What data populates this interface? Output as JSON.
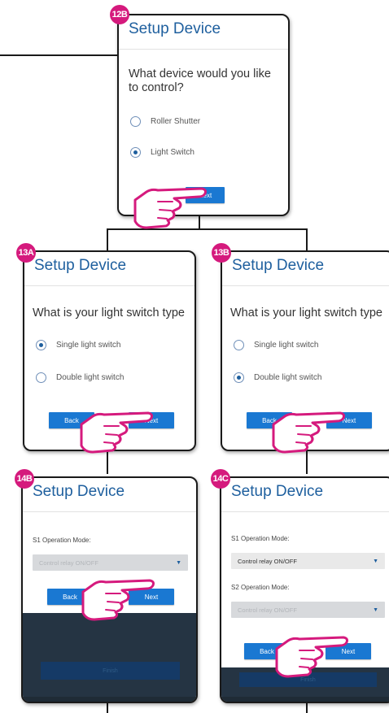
{
  "screens": {
    "s12b": {
      "badge": "12B",
      "title": "Setup Device",
      "question": "What device would you like to control?",
      "options": [
        {
          "label": "Roller Shutter",
          "selected": false
        },
        {
          "label": "Light Switch",
          "selected": true
        }
      ],
      "next_label": "Next"
    },
    "s13a": {
      "badge": "13A",
      "title": "Setup Device",
      "question": "What is your light switch type",
      "options": [
        {
          "label": "Single light switch",
          "selected": true
        },
        {
          "label": "Double light switch",
          "selected": false
        }
      ],
      "back_label": "Back",
      "next_label": "Next"
    },
    "s13b": {
      "badge": "13B",
      "title": "Setup Device",
      "question": "What is your light switch type",
      "options": [
        {
          "label": "Single light switch",
          "selected": false
        },
        {
          "label": "Double light switch",
          "selected": true
        }
      ],
      "back_label": "Back",
      "next_label": "Next"
    },
    "s14b": {
      "badge": "14B",
      "title": "Setup Device",
      "s1_label": "S1 Operation Mode:",
      "s1_value": "Control relay ON/OFF",
      "back_label": "Back",
      "next_label": "Next",
      "bg_button": "Finish"
    },
    "s14c": {
      "badge": "14C",
      "title": "Setup Device",
      "s1_label": "S1 Operation Mode:",
      "s1_value": "Control relay ON/OFF",
      "s2_label": "S2 Operation Mode:",
      "s2_value": "Control relay ON/OFF",
      "back_label": "Back",
      "next_label": "Next",
      "bg_button": "Finish"
    }
  },
  "colors": {
    "badge": "#d51a7d",
    "title": "#1e5f9e",
    "button": "#1a78d2",
    "hand_outline": "#d51a7d",
    "connector": "#1a1a1a"
  },
  "icons": {
    "pointer": "hand-pointer-icon",
    "dropdown": "caret-down-icon"
  }
}
